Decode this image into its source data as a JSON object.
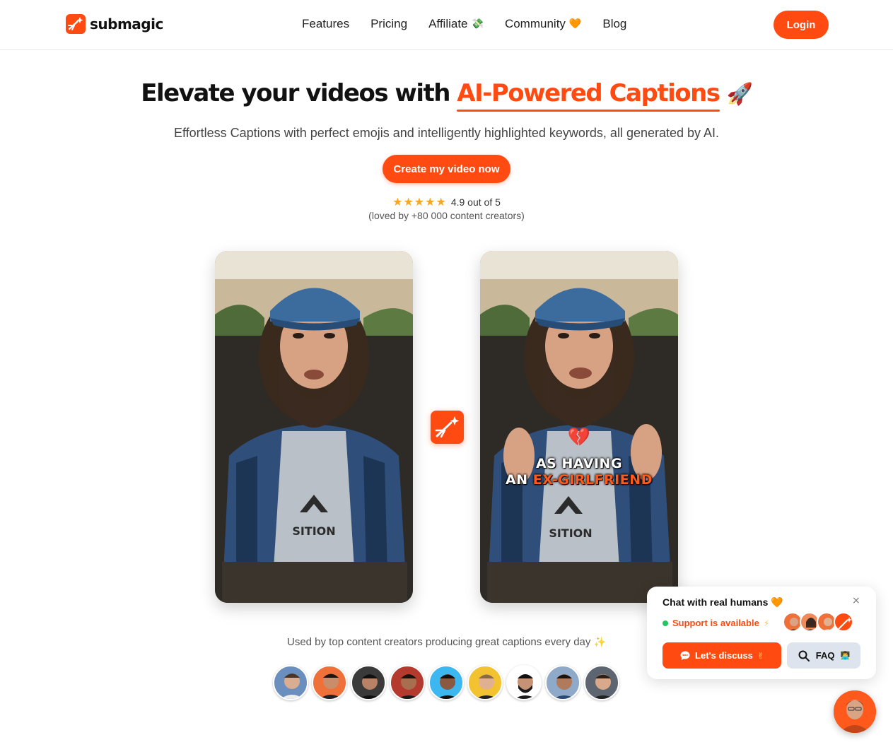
{
  "colors": {
    "accent": "#ff4a12",
    "star": "#f5a623",
    "online": "#22c55e"
  },
  "nav": {
    "logo_text": "submagic",
    "links": [
      {
        "label": "Features",
        "emoji": ""
      },
      {
        "label": "Pricing",
        "emoji": ""
      },
      {
        "label": "Affiliate",
        "emoji": "💸"
      },
      {
        "label": "Community",
        "emoji": "🧡"
      },
      {
        "label": "Blog",
        "emoji": ""
      }
    ],
    "login_label": "Login"
  },
  "hero": {
    "title_prefix": "Elevate your videos with",
    "title_highlight": "AI-Powered Captions",
    "title_emoji": "🚀",
    "subtitle": "Effortless Captions with perfect emojis and intelligently highlighted keywords, all generated by AI.",
    "cta_label": "Create my video now",
    "stars": "★★★★★",
    "rating_text": "4.9 out of 5",
    "loved_text": "(loved by +80 000 content creators)"
  },
  "videos": {
    "after_caption_emoji": "💔",
    "after_caption_line1": "AS HAVING",
    "after_caption_line2_plain": "AN",
    "after_caption_line2_highlight": "EX-GIRLFRIEND",
    "shirt_text": "SITION"
  },
  "social_proof": {
    "text": "Used by top content creators producing great captions every day",
    "emoji": "✨",
    "avatar_count": 9
  },
  "chat": {
    "title": "Chat with real humans",
    "title_emoji": "🧡",
    "close_icon": "×",
    "status": "Support is available",
    "status_emoji": "⚡",
    "discuss_label": "Let's discuss",
    "discuss_emoji": "✌",
    "faq_label": "FAQ",
    "faq_emoji": "👨‍💻"
  }
}
